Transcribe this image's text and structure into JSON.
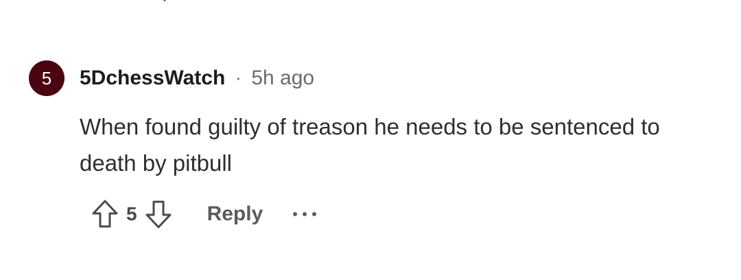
{
  "comment": {
    "avatar_label": "5",
    "avatar_color": "#4a0610",
    "username": "5DchessWatch",
    "separator": "·",
    "timestamp": "5h ago",
    "body": "When found guilty of treason he needs to be sentenced to death by pitbull",
    "score": "5",
    "reply_label": "Reply",
    "icons": {
      "upvote": "arrow-up-outline-icon",
      "downvote": "arrow-down-outline-icon",
      "more": "more-horizontal-icon"
    }
  }
}
